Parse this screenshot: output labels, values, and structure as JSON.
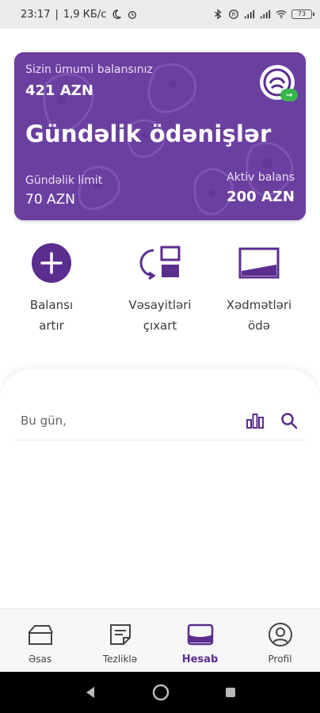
{
  "status_bar": {
    "time": "23:17",
    "speed": "1,9 КБ/с",
    "battery": "73"
  },
  "card": {
    "total_balance_label": "Sizin ümumi balansınız",
    "total_balance_value": "421 AZN",
    "title": "Gündəlik ödənişlər",
    "daily_limit_label": "Gündəlik limit",
    "daily_limit_value": "70 AZN",
    "active_balance_label": "Aktiv balans",
    "active_balance_value": "200 AZN",
    "color": "#6b3fa0",
    "logo_badge_color": "#39b54a"
  },
  "actions": [
    {
      "label": "Balansı\nartır",
      "icon": "plus-circle-icon"
    },
    {
      "label": "Vəsayitləri\nçıxart",
      "icon": "withdraw-icon"
    },
    {
      "label": "Xədmətləri\nödə",
      "icon": "card-pay-icon"
    }
  ],
  "today": {
    "label": "Bu gün,",
    "icons": [
      "chart-icon",
      "search-icon"
    ]
  },
  "bottom_nav": [
    {
      "label": "Əsas",
      "icon": "home-icon",
      "active": false
    },
    {
      "label": "Tezliklə",
      "icon": "note-icon",
      "active": false
    },
    {
      "label": "Hesab",
      "icon": "wallet-icon",
      "active": true
    },
    {
      "label": "Profil",
      "icon": "profile-icon",
      "active": false
    }
  ],
  "accent_color": "#5b2d8f"
}
